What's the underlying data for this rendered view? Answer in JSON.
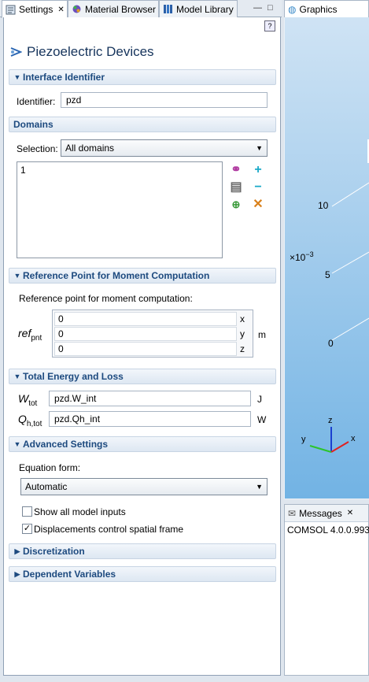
{
  "tabs": [
    {
      "label": "Settings",
      "icon": "settings-icon"
    },
    {
      "label": "Material Browser",
      "icon": "material-browser-icon"
    },
    {
      "label": "Model Library",
      "icon": "model-library-icon"
    }
  ],
  "window_buttons": {
    "minimize": "—",
    "maximize": "□"
  },
  "title": "Piezoelectric Devices",
  "sections": {
    "interface_identifier": "Interface Identifier",
    "domains": "Domains",
    "reference_point": "Reference Point for Moment Computation",
    "total_energy": "Total Energy and Loss",
    "advanced": "Advanced Settings",
    "discretization": "Discretization",
    "dependent_variables": "Dependent Variables"
  },
  "identifier": {
    "label": "Identifier:",
    "value": "pzd"
  },
  "domains": {
    "selection_label": "Selection:",
    "selection_value": "All domains",
    "list": [
      "1"
    ]
  },
  "reference_point": {
    "description": "Reference point for moment computation:",
    "symbol": "ref",
    "subscript": "pnt",
    "rows": [
      {
        "value": "0",
        "axis": "x"
      },
      {
        "value": "0",
        "axis": "y"
      },
      {
        "value": "0",
        "axis": "z"
      }
    ],
    "unit": "m"
  },
  "energy": {
    "w_symbol": "W",
    "w_sub": "tot",
    "w_value": "pzd.W_int",
    "w_unit": "J",
    "q_symbol": "Q",
    "q_sub": "h,tot",
    "q_value": "pzd.Qh_int",
    "q_unit": "W"
  },
  "advanced": {
    "equation_form_label": "Equation form:",
    "equation_form_value": "Automatic",
    "show_inputs_label": "Show all model inputs",
    "show_inputs_checked": false,
    "displacements_label": "Displacements control spatial frame",
    "displacements_checked": true
  },
  "graphics": {
    "tab_label": "Graphics",
    "tick_10": "10",
    "exponent": "×10",
    "exponent_power": "−3",
    "tick_5": "5",
    "tick_0": "0",
    "axis_x": "x",
    "axis_y": "y",
    "axis_z": "z"
  },
  "messages": {
    "tab_label": "Messages",
    "close": "✕",
    "text": "COMSOL 4.0.0.993"
  }
}
